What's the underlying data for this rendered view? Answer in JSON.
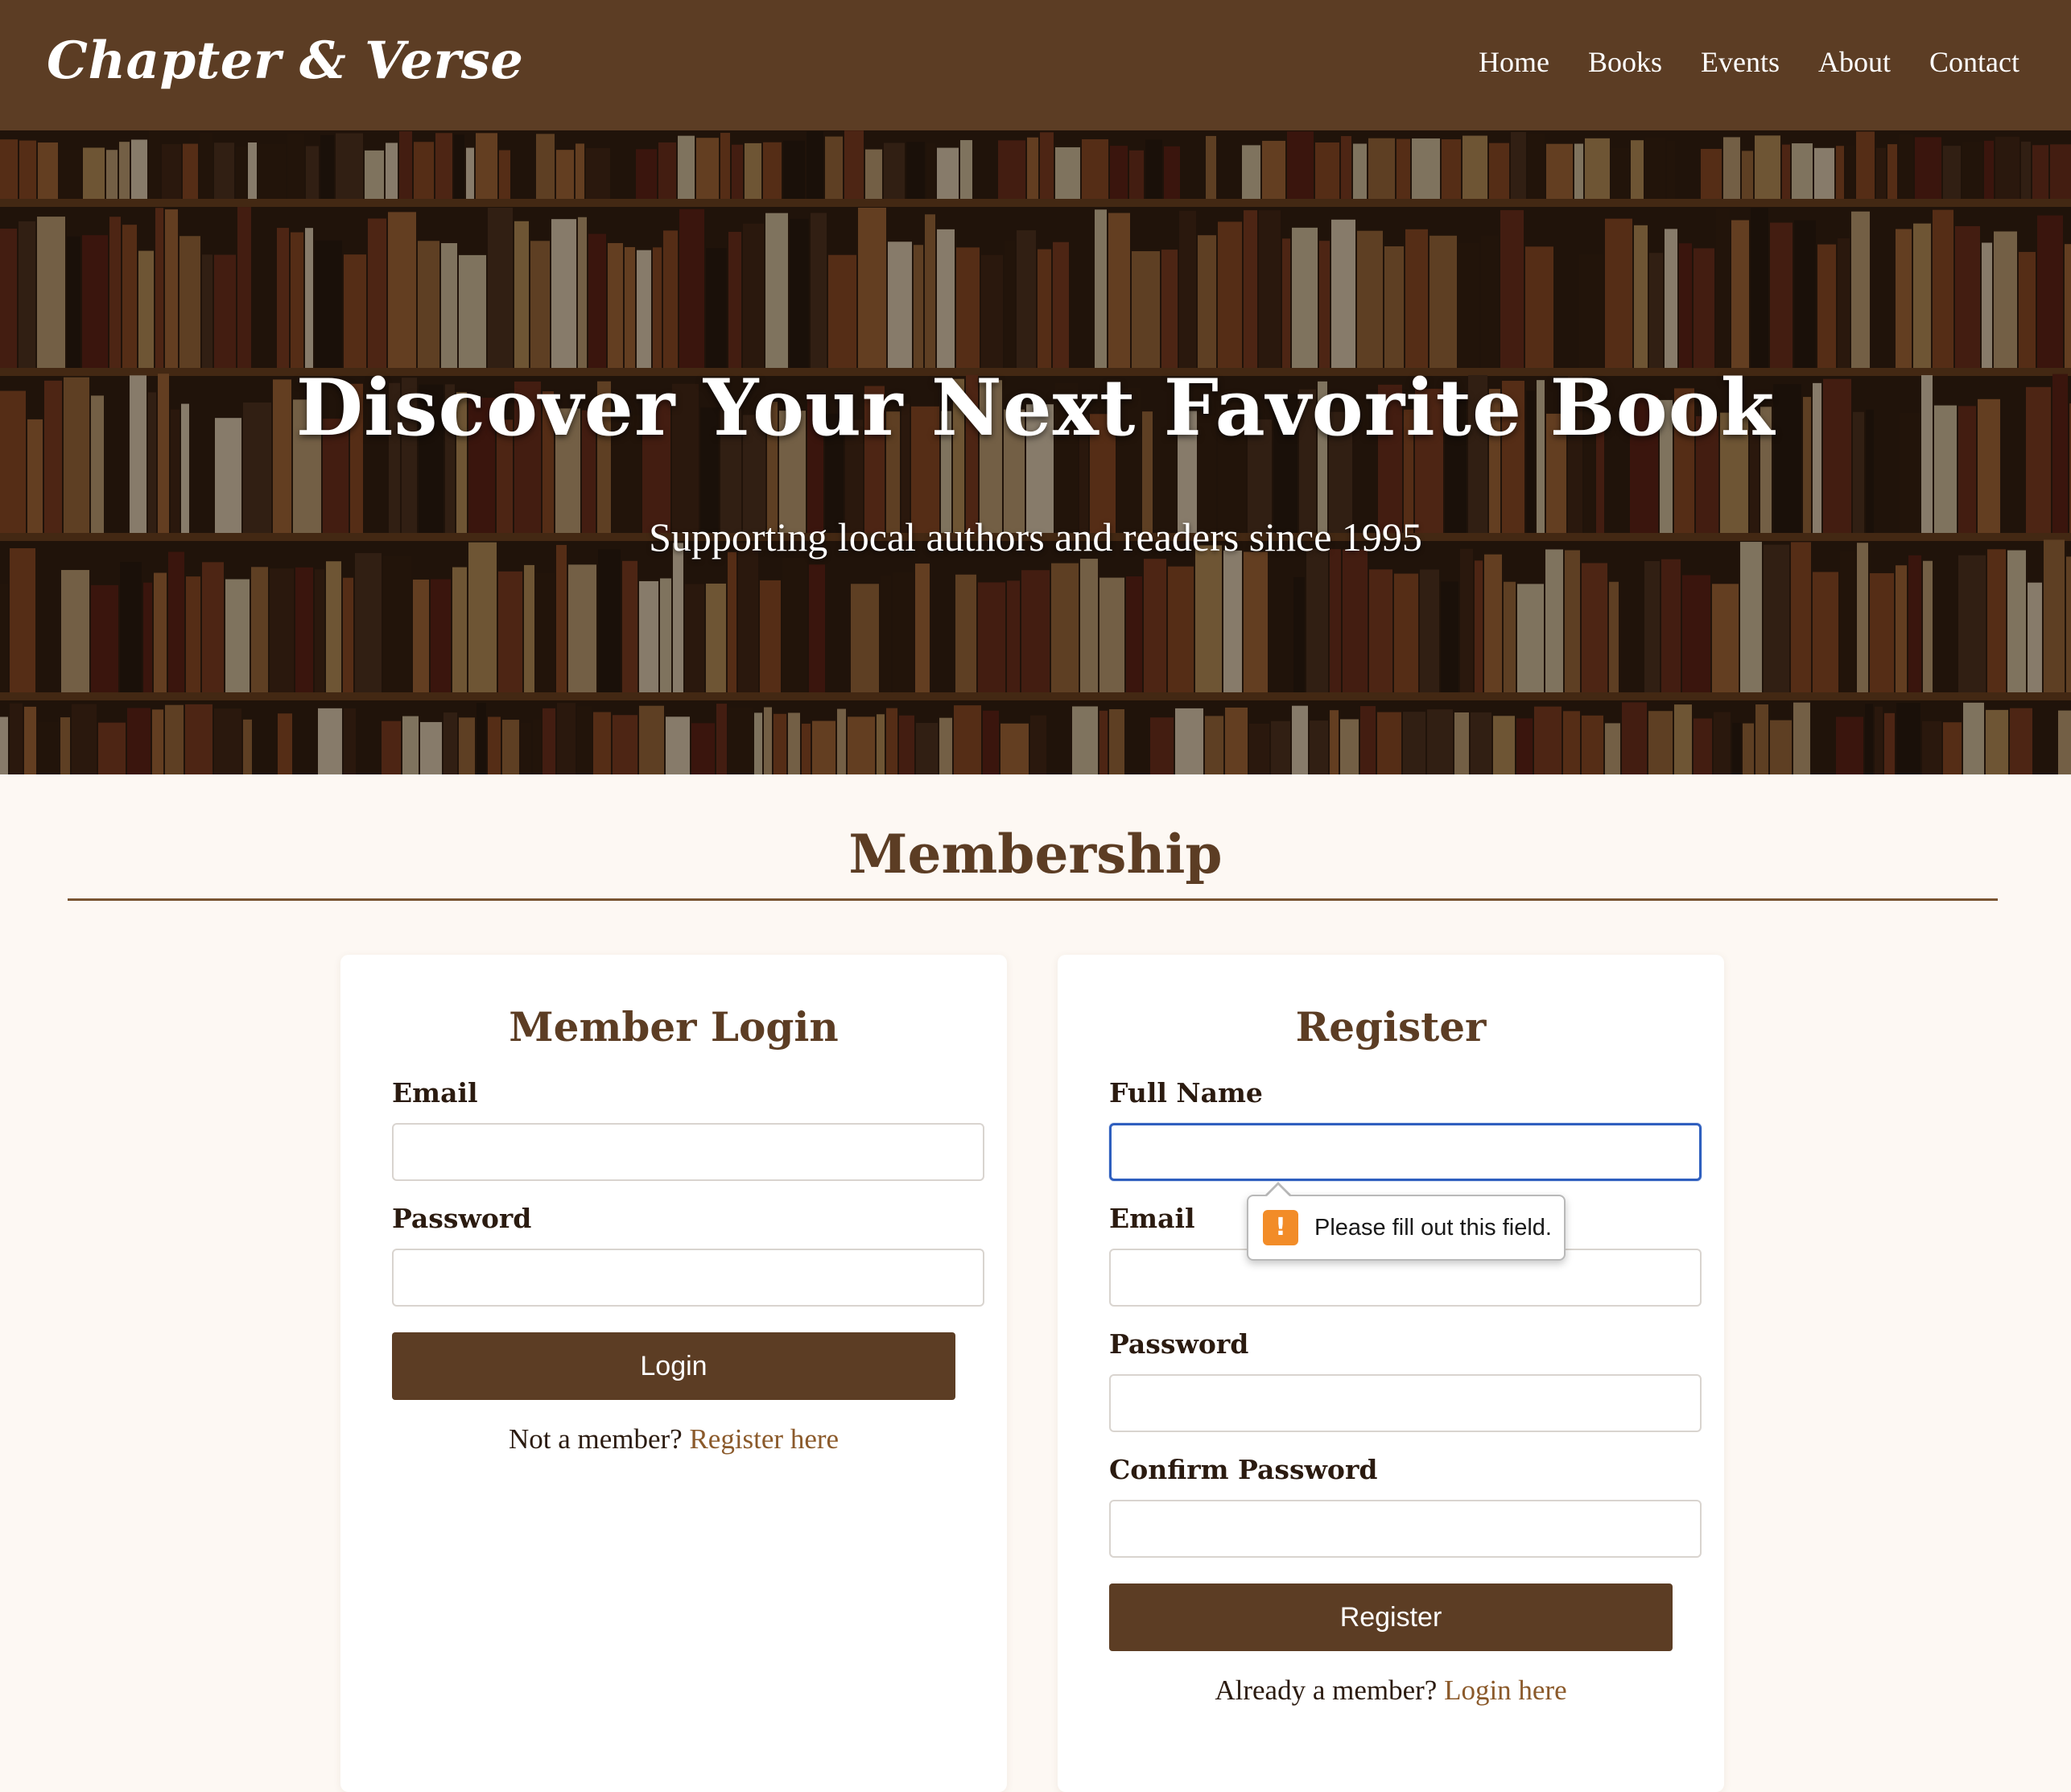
{
  "header": {
    "brand": "Chapter & Verse",
    "nav": [
      "Home",
      "Books",
      "Events",
      "About",
      "Contact"
    ]
  },
  "hero": {
    "title": "Discover Your Next Favorite Book",
    "subtitle": "Supporting local authors and readers since 1995"
  },
  "membership": {
    "title": "Membership",
    "login": {
      "title": "Member Login",
      "email_label": "Email",
      "email_value": "",
      "password_label": "Password",
      "password_value": "",
      "button": "Login",
      "switch_text": "Not a member?",
      "switch_link": "Register here"
    },
    "register": {
      "title": "Register",
      "fullname_label": "Full Name",
      "fullname_value": "",
      "email_label": "Email",
      "email_value": "",
      "password_label": "Password",
      "password_value": "",
      "confirm_label": "Confirm Password",
      "confirm_value": "",
      "button": "Register",
      "switch_text": "Already a member?",
      "switch_link": "Login here"
    }
  },
  "tooltip": {
    "icon": "warning-icon",
    "icon_glyph": "!",
    "message": "Please fill out this field."
  },
  "colors": {
    "brand_brown": "#5c3d24",
    "link_brown": "#8b5a2b",
    "page_bg": "#fdf8f3",
    "focus_blue": "#2f5fbf",
    "warning_orange": "#f28c28"
  }
}
